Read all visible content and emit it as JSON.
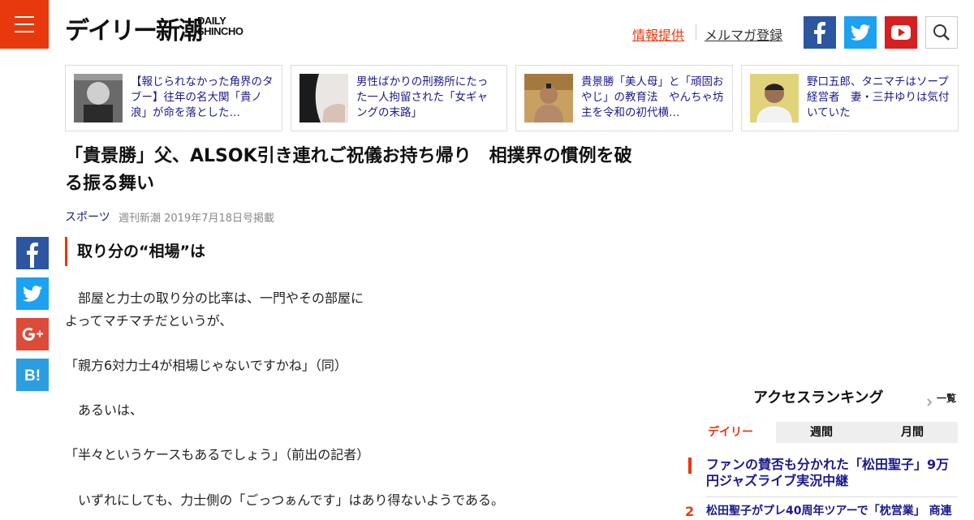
{
  "header": {
    "logo_jp": "デイリー新潮",
    "logo_en_1": "DAILY",
    "logo_en_2": "SHINCHO",
    "info_link": "情報提供",
    "newsletter_link": "メルマガ登録",
    "colors": {
      "accent": "#e8380d",
      "facebook": "#2d56a0",
      "twitter": "#1da1f2",
      "youtube": "#d61f1f",
      "link": "#1a1a8c"
    }
  },
  "cards": [
    {
      "text": "【報じられなかった角界のタブー】往年の名大関「貴ノ浪」が命を落とした…"
    },
    {
      "text": "男性ばかりの刑務所にたった一人拘留された「女ギャングの末路」"
    },
    {
      "text": "貴景勝「美人母」と「頑固おやじ」の教育法　やんちゃ坊主を令和の初代横…"
    },
    {
      "text": "野口五郎、タニマチはソープ経営者　妻・三井ゆりは気付いていた"
    }
  ],
  "article": {
    "title": "「貴景勝」父、ALSOK引き連れご祝儀お持ち帰り　相撲界の慣例を破る振る舞い",
    "category": "スポーツ",
    "pub_info": "週刊新潮 2019年7月18日号掲載",
    "section_heading": "取り分の“相場”は",
    "paragraphs": [
      "　部屋と力士の取り分の比率は、一門やその部屋に\nよってマチマチだというが、",
      "「親方6対力士4が相場じゃないですかね」（同）",
      "　あるいは、",
      "「半々というケースもあるでしょう」（前出の記者）",
      "　いずれにしても、力士側の「ごっつぁんです」はあり得ないようである。"
    ]
  },
  "ranking": {
    "title": "アクセスランキング",
    "more": "一覧",
    "tabs": [
      "デイリー",
      "週間",
      "月間"
    ],
    "items": [
      {
        "rank": "1",
        "text": "ファンの賛否も分かれた「松田聖子」9万円ジャズライブ実況中継"
      },
      {
        "rank": "2",
        "text": "松田聖子がプレ40周年ツアーで「枕営業」 商連"
      }
    ]
  }
}
